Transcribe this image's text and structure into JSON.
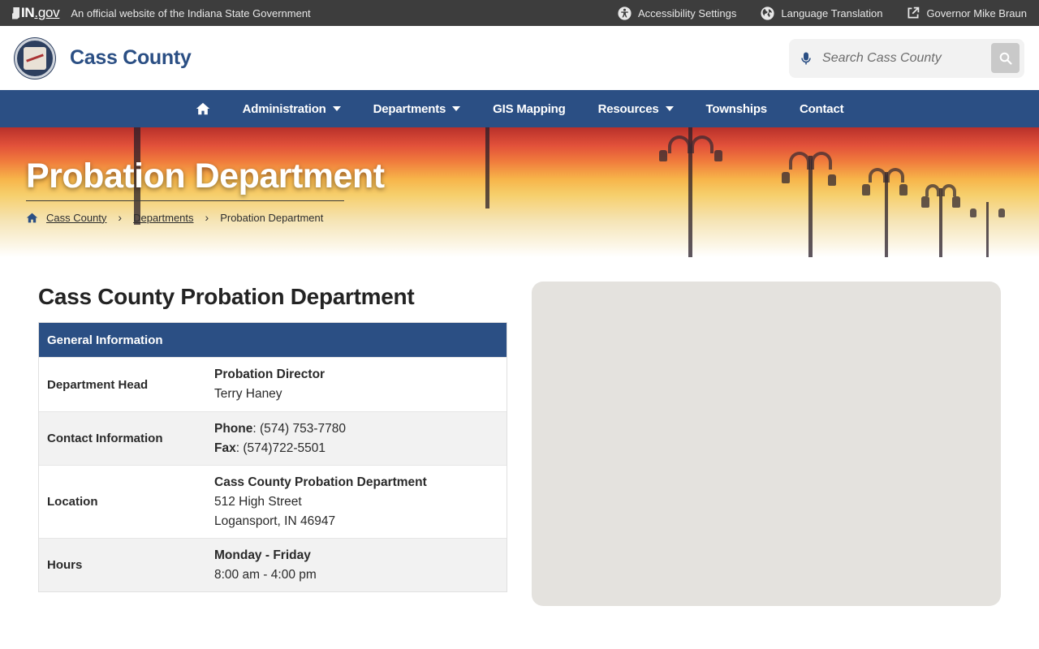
{
  "topbar": {
    "logo_in": "IN",
    "logo_gov": ".gov",
    "official_text": "An official website of the Indiana State Government",
    "links": [
      {
        "label": "Accessibility Settings",
        "icon": "accessibility-icon"
      },
      {
        "label": "Language Translation",
        "icon": "globe-icon"
      },
      {
        "label": "Governor Mike Braun",
        "icon": "external-link-icon"
      }
    ]
  },
  "header": {
    "site_title": "Cass County",
    "search_placeholder": "Search Cass County"
  },
  "nav": {
    "items": [
      {
        "label": "Administration",
        "dropdown": true
      },
      {
        "label": "Departments",
        "dropdown": true
      },
      {
        "label": "GIS Mapping",
        "dropdown": false
      },
      {
        "label": "Resources",
        "dropdown": true
      },
      {
        "label": "Townships",
        "dropdown": false
      },
      {
        "label": "Contact",
        "dropdown": false
      }
    ]
  },
  "hero": {
    "title": "Probation Department",
    "breadcrumb": [
      "Cass County",
      "Departments",
      "Probation Department"
    ]
  },
  "main": {
    "heading": "Cass County Probation Department",
    "table_header": "General Information",
    "rows": {
      "head": {
        "label": "Department Head",
        "title": "Probation Director",
        "name": "Terry Haney"
      },
      "contact": {
        "label": "Contact Information",
        "phone_label": "Phone",
        "phone": ": (574) 753-7780",
        "fax_label": "Fax",
        "fax": ": (574)722-5501"
      },
      "location": {
        "label": "Location",
        "name": "Cass County Probation Department",
        "street": "512 High Street",
        "city": "Logansport, IN 46947"
      },
      "hours": {
        "label": "Hours",
        "days": "Monday - Friday",
        "time": "8:00 am - 4:00 pm"
      }
    }
  },
  "colors": {
    "topbar": "#3d3d3d",
    "brand_blue": "#2b4f84",
    "map_placeholder": "#e4e2de"
  }
}
